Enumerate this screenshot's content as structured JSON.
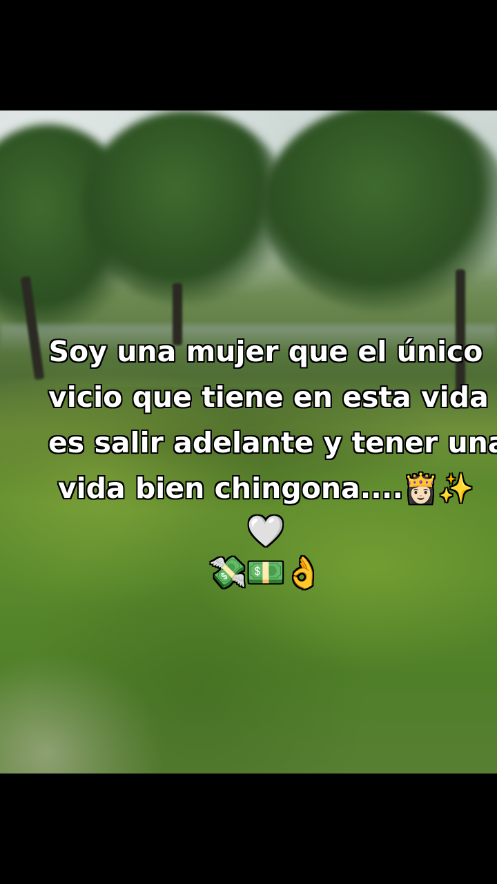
{
  "caption": {
    "lines": [
      "Soy una mujer que el único",
      "vicio que tiene en esta vida",
      "es salir adelante y tener una",
      "vida bien chingona....👸🏻✨"
    ],
    "emoji_line_1": "🤍",
    "emoji_line_2": "💸💵👌"
  },
  "background": {
    "scene": "blurred park with trees and grass",
    "colors": {
      "grass": "#5a8a2c",
      "foliage": "#2c4f22",
      "sky": "#cfd9d6",
      "letterbox": "#000000"
    }
  }
}
